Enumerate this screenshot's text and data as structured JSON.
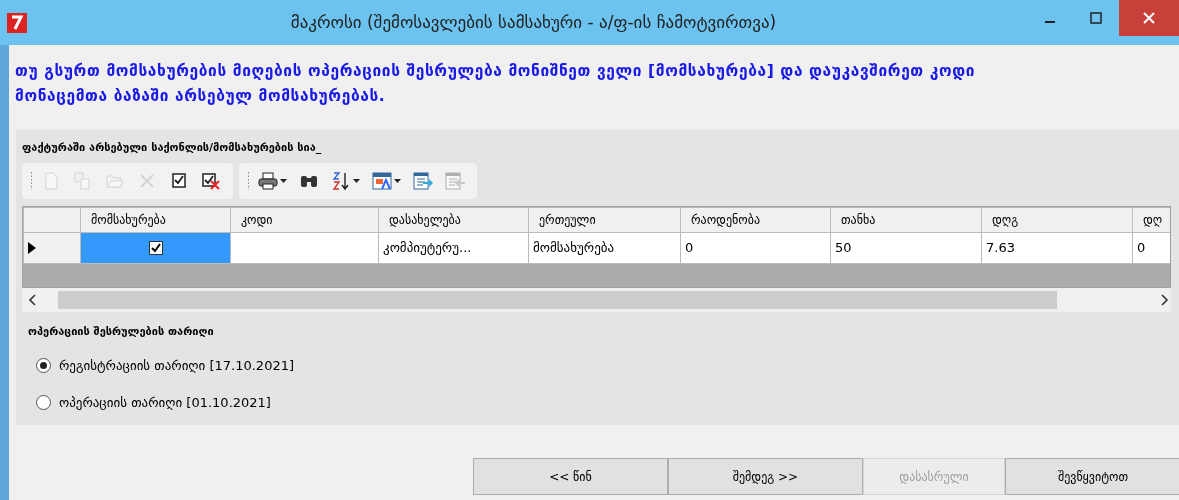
{
  "window": {
    "title": "მაკროსი (შემოსავლების სამსახური - ა/ფ-ის ჩამოტვირთვა)"
  },
  "instruction": "თუ გსურთ მომსახურების მიღების ოპერაციის შესრულება მონიშნეთ ველი [მომსახურება] და დაუკავშირეთ კოდი მონაცემთა ბაზაში არსებულ მომსახურებას.",
  "list_title": "ფაქტურაში არსებული საქონლის/მომსახურების სია_",
  "toolbar": [
    {
      "group": [
        {
          "kind": "new",
          "disabled": true,
          "menu": false
        },
        {
          "kind": "copy",
          "disabled": true,
          "menu": false
        },
        {
          "kind": "open",
          "disabled": true,
          "menu": false
        },
        {
          "kind": "delete",
          "disabled": true,
          "menu": false
        },
        {
          "kind": "check",
          "disabled": false,
          "menu": false
        },
        {
          "kind": "uncheck",
          "disabled": false,
          "menu": false
        }
      ]
    },
    {
      "group": [
        {
          "kind": "print",
          "disabled": false,
          "menu": true
        },
        {
          "kind": "find",
          "disabled": false,
          "menu": false
        },
        {
          "kind": "sort",
          "disabled": false,
          "menu": true
        },
        {
          "kind": "format",
          "disabled": false,
          "menu": true
        },
        {
          "kind": "export",
          "disabled": false,
          "menu": false
        },
        {
          "kind": "import",
          "disabled": true,
          "menu": false
        }
      ]
    }
  ],
  "table": {
    "columns": [
      "მომსახურება",
      "კოდი",
      "დასახელება",
      "ერთეული",
      "რაოდენობა",
      "თანხა",
      "დღგ",
      "დღ"
    ],
    "rows": [
      {
        "current": true,
        "service_checked": true,
        "service_selected": true,
        "name": "კომპიუტერუ...",
        "unit": "მომსახურება",
        "quantity": "0",
        "amount": "50",
        "vat": "7.63",
        "column_8": "0"
      }
    ]
  },
  "date_group": {
    "title": "ოპერაციის შესრულების თარიღი",
    "options": [
      {
        "label": "რეგისტრაციის თარიღი [17.10.2021]",
        "selected": true
      },
      {
        "label": "ოპერაციის თარიღი [01.10.2021]",
        "selected": false
      }
    ]
  },
  "buttons": [
    {
      "label": "<< წინ",
      "disabled": false
    },
    {
      "label": "შემდეგ >>",
      "disabled": false
    },
    {
      "label": "დასასრული",
      "disabled": true
    },
    {
      "label": "შევწყვიტოთ",
      "disabled": false
    }
  ]
}
